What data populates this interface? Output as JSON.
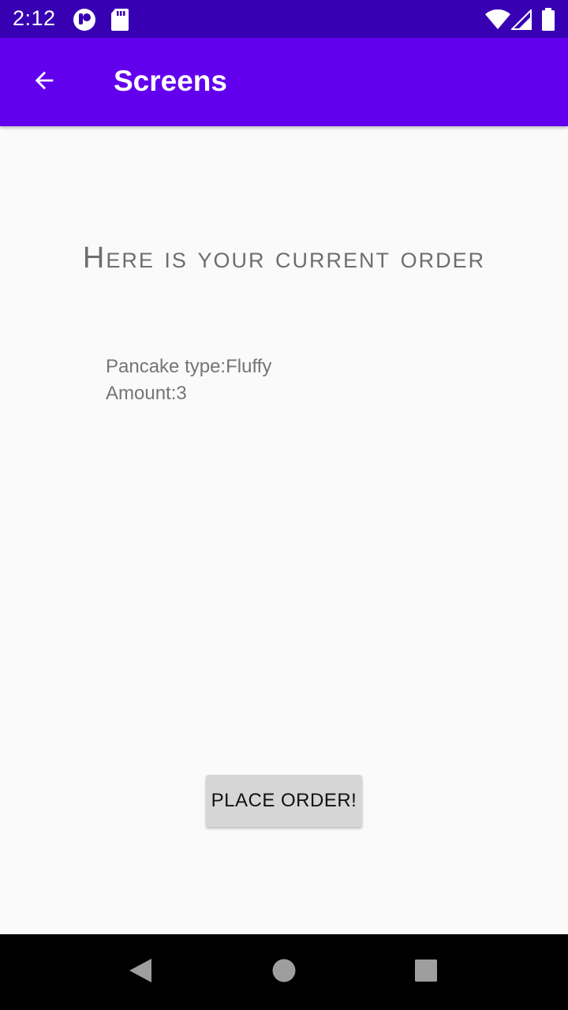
{
  "status_bar": {
    "time": "2:12",
    "icons": [
      "notification-app-icon",
      "sd-card-icon",
      "wifi-icon",
      "signal-icon",
      "battery-icon"
    ]
  },
  "app_bar": {
    "title": "Screens",
    "back_icon": "arrow-back-icon",
    "background": "#6200ee",
    "status_background": "#3700b3"
  },
  "main": {
    "heading": "Here is your current order",
    "order_type": "Pancake type:Fluffy",
    "order_amount": "Amount:3",
    "place_order_label": "PLACE ORDER!"
  },
  "nav_bar": {
    "icons": [
      "back-triangle-icon",
      "home-circle-icon",
      "recents-square-icon"
    ]
  }
}
